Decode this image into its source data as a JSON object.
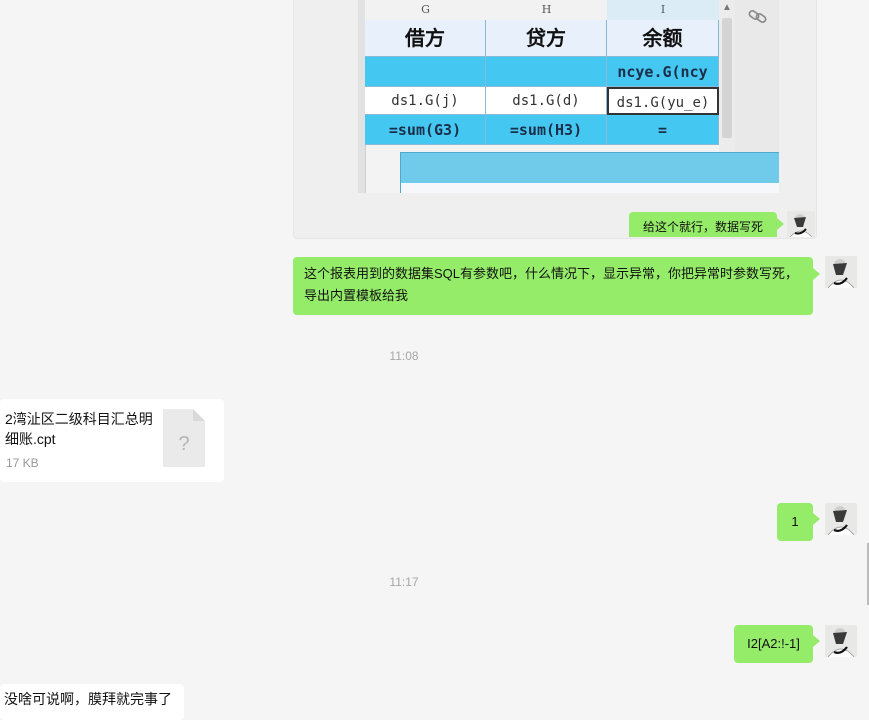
{
  "quoted_screenshot": {
    "columns": [
      "G",
      "H",
      "I"
    ],
    "headers": [
      "借方",
      "贷方",
      "余额"
    ],
    "row_blue": [
      "",
      "",
      "ncye.G(ncy"
    ],
    "row_formulas": [
      "ds1.G(j)",
      "ds1.G(d)",
      "ds1.G(yu_e)"
    ],
    "row_sums": [
      "=sum(G3)",
      "=sum(H3)",
      "="
    ]
  },
  "messages": {
    "m1": "给这个就行，数据写死",
    "m2": "这个报表用到的数据集SQL有参数吧，什么情况下，显示异常，你把异常时参数写死，导出内置模板给我",
    "time1": "11:08",
    "file": {
      "name": "2湾沚区二级科目汇总明细账.cpt",
      "size": "17 KB",
      "icon": "?"
    },
    "m3": "1",
    "time2": "11:17",
    "m4": "I2[A2:!-1]",
    "m5": "没啥可说啊，膜拜就完事了"
  },
  "colors": {
    "sent_bubble": "#95ec69",
    "received_bubble": "#ffffff",
    "background": "#f5f5f5",
    "cell_blue": "#44c7f0"
  }
}
